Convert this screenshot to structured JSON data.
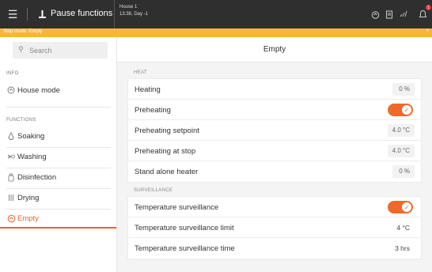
{
  "header": {
    "menu_icon": "hamburger-icon",
    "title": "Pause functions",
    "title_icon": "pause-icon",
    "house_name": "House 1",
    "house_time": "13:38, Day -1",
    "icons": [
      "home-icon",
      "document-icon",
      "signal-icon",
      "bell-icon"
    ],
    "notification_count": "1"
  },
  "notification": {
    "text": "Stop mode: Empty",
    "close_label": "×",
    "color": "#f7b733"
  },
  "sidebar": {
    "search_placeholder": "Search",
    "info_heading": "INFO",
    "info_items": [
      {
        "label": "House mode",
        "icon": "house-mode-icon"
      }
    ],
    "functions_heading": "FUNCTIONS",
    "function_items": [
      {
        "label": "Soaking",
        "icon": "droplet-icon"
      },
      {
        "label": "Washing",
        "icon": "washing-icon"
      },
      {
        "label": "Disinfection",
        "icon": "disinfection-icon"
      },
      {
        "label": "Drying",
        "icon": "drying-icon"
      },
      {
        "label": "Empty",
        "icon": "empty-icon",
        "active": true
      }
    ]
  },
  "main": {
    "title": "Empty",
    "heat_heading": "HEAT",
    "heat_rows": [
      {
        "label": "Heating",
        "value": "0 %"
      },
      {
        "label": "Preheating",
        "toggle": true
      },
      {
        "label": "Preheating setpoint",
        "value": "4.0 °C"
      },
      {
        "label": "Preheating at stop",
        "value": "4.0 °C"
      },
      {
        "label": "Stand alone heater",
        "value": "0 %"
      }
    ],
    "surveillance_heading": "SURVEILLANCE",
    "surveillance_rows": [
      {
        "label": "Temperature surveillance",
        "toggle": true
      },
      {
        "label": "Temperature surveillance limit",
        "value": "4 °C"
      },
      {
        "label": "Temperature surveillance time",
        "value": "3 hrs"
      }
    ]
  },
  "colors": {
    "accent": "#ee6a2b",
    "topbar": "#2f2f2f",
    "warning": "#f7b733"
  }
}
